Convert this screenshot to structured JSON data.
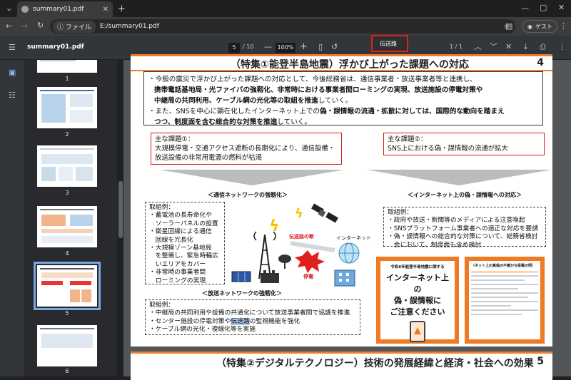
{
  "browser": {
    "tab_title": "summary01.pdf",
    "new_tab_icon": "plus-icon",
    "chip_label": "ファイル",
    "url": "E:/summary01.pdf",
    "guest_label": "ゲスト"
  },
  "pdf_toolbar": {
    "file_name": "summary01.pdf",
    "current_page": "5",
    "total_pages": "/ 10",
    "zoom": "100%"
  },
  "find": {
    "query": "伝送路",
    "count": "1 / 1"
  },
  "thumbnails": [
    {
      "label": "1"
    },
    {
      "label": "2"
    },
    {
      "label": "3"
    },
    {
      "label": "4"
    },
    {
      "label": "5"
    },
    {
      "label": "6"
    }
  ],
  "page4": {
    "title": "（特集①能登半島地震）浮かび上がった課題への対応",
    "number": "4",
    "intro": {
      "line1a": "・今般の震災で浮かび上がった課題への対応として、今後総務省は、通信事業者・放送事業者等と連携し、",
      "line2": "携帯電話基地局・光ファイバの強靱化、非常時における事業者間ローミングの実現、放送施設の停電対策や",
      "line3a": "中継局の共同利用、ケーブル網の光化等の取組を推進",
      "line3b": "していく。",
      "line4a": "・また、SNSを中心に顕在化したインターネット上での",
      "line4b": "偽・誤情報の流通・拡散に対しては、国際的な動向を踏まえ",
      "line5a": "つつ、制度面を含む総合的な対策を推進",
      "line5b": "していく。"
    },
    "issue1": {
      "title": "主な課題①：",
      "line1": "大規模停電・交通アクセス遮断の長期化により、通信設備・",
      "line2": "放送設備の非常用電源の燃料が枯渇"
    },
    "issue2": {
      "title": "主な課題②：",
      "line1": "SNS上における偽・誤情報の流通が拡大"
    },
    "label_network": "＜通信ネットワークの強靱化＞",
    "label_internet": "＜インターネット上の偽・誤情報への対応＞",
    "label_broadcast": "＜放送ネットワークの強靱化＞",
    "ex_network": {
      "title": "取組例：",
      "items": [
        "・蓄電池の長寿命化や",
        "　ソーラーパネルの設置",
        "・衛星回線による通信",
        "　回線を冗長化",
        "・大規模ゾーン基地局",
        "　を整備し、緊急時輻広",
        "　いエリアをカバー",
        "・非常時の事業者間",
        "　ローミングの実現"
      ]
    },
    "ex_internet": {
      "title": "取組例：",
      "items": [
        "・政府や放送・新聞等のメディアによる注意喚起",
        "・SNSプラットフォーム事業者への適正な対応を要請",
        "・偽・誤情報への総合的な対策について、総務省検討",
        "　会において、制度面も含め検討"
      ]
    },
    "ex_broadcast": {
      "title": "取組例：",
      "item1": "・中継局の共同利用や設備の共通化について放送事業者間で協議を推進",
      "item2a": "・センター施設の停電対策や",
      "item2b": "伝送路",
      "item2c": "の監視機能を強化",
      "item3": "・ケーブル網の光化・複線化等を実施"
    },
    "diagram": {
      "path_break": "伝送路の断",
      "internet": "インターネット",
      "outage": "停電"
    },
    "poster1": {
      "small": "令和6年能登半島地震に関する",
      "big1": "インターネット上の",
      "big2": "偽・誤情報に",
      "big3": "ご注意ください"
    },
    "poster2": {
      "heading": "（ネット上の真偽の不確かな投稿の例）"
    }
  },
  "page5": {
    "title": "（特集②デジタルテクノロジー）技術の発展経緯と経済・社会への効果",
    "number": "5"
  }
}
